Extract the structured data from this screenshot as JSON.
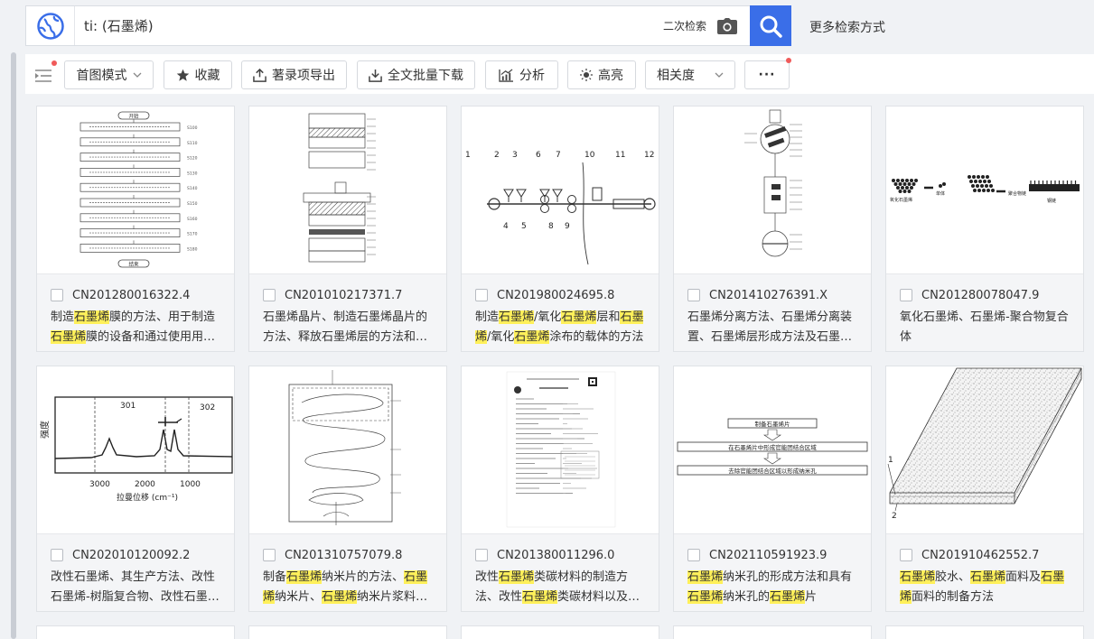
{
  "search": {
    "query": "ti: (石墨烯)",
    "secondary_label": "二次检索",
    "more_label": "更多检索方式"
  },
  "toolbar": {
    "mode_label": "首图模式",
    "favorite_label": "收藏",
    "export_label": "著录项导出",
    "download_label": "全文批量下载",
    "analysis_label": "分析",
    "highlight_label": "高亮",
    "sort_label": "相关度",
    "more_label": "···"
  },
  "results": [
    {
      "pn": "CN201280016322.4",
      "title": [
        {
          "t": "制造"
        },
        {
          "t": "石墨烯",
          "h": true
        },
        {
          "t": "膜的方法、用于制造"
        },
        {
          "t": "石墨烯",
          "h": true
        },
        {
          "t": "膜的设备和通过使用用于制造石墨烯膜的设备制造的石墨烯膜"
        }
      ]
    },
    {
      "pn": "CN201010217371.7",
      "title": [
        {
          "t": "石墨烯晶片、制造石墨烯晶片的方法、释放石墨烯层的方法和制造装置的方法"
        }
      ]
    },
    {
      "pn": "CN201980024695.8",
      "title": [
        {
          "t": "制造"
        },
        {
          "t": "石墨烯",
          "h": true
        },
        {
          "t": "/氧化"
        },
        {
          "t": "石墨烯",
          "h": true
        },
        {
          "t": "层和"
        },
        {
          "t": "石墨烯",
          "h": true
        },
        {
          "t": "/氧化"
        },
        {
          "t": "石墨烯",
          "h": true
        },
        {
          "t": "涂布的载体的方法"
        }
      ]
    },
    {
      "pn": "CN201410276391.X",
      "title": [
        {
          "t": "石墨烯分离方法、石墨烯分离装置、石墨烯层形成方法及石墨烯层形成装置"
        }
      ]
    },
    {
      "pn": "CN201280078047.9",
      "title": [
        {
          "t": "氧化石墨烯、石墨烯-聚合物复合体"
        }
      ]
    },
    {
      "pn": "CN202010120092.2",
      "title": [
        {
          "t": "改性石墨烯、其生产方法、改性石墨烯-树脂复合物、改性石墨烯片材及改性石墨烯分散液"
        }
      ]
    },
    {
      "pn": "CN201310757079.8",
      "title": [
        {
          "t": "制备"
        },
        {
          "t": "石墨烯",
          "h": true
        },
        {
          "t": "纳米片的方法、"
        },
        {
          "t": "石墨烯",
          "h": true
        },
        {
          "t": "纳米片、"
        },
        {
          "t": "石墨烯",
          "h": true
        },
        {
          "t": "纳米片浆料和包含石墨烯纳米片的制品"
        }
      ]
    },
    {
      "pn": "CN201380011296.0",
      "title": [
        {
          "t": "改性"
        },
        {
          "t": "石墨烯",
          "h": true
        },
        {
          "t": "类碳材料的制造方法、改性"
        },
        {
          "t": "石墨烯",
          "h": true
        },
        {
          "t": "类碳材料以及含有改性石墨烯类碳材料的树脂复合材料"
        }
      ]
    },
    {
      "pn": "CN202110591923.9",
      "title": [
        {
          "t": "石墨烯",
          "h": true
        },
        {
          "t": "纳米孔的形成方法和具有"
        },
        {
          "t": "石墨烯",
          "h": true
        },
        {
          "t": "纳米孔的"
        },
        {
          "t": "石墨烯",
          "h": true
        },
        {
          "t": "片"
        }
      ]
    },
    {
      "pn": "CN201910462552.7",
      "title": [
        {
          "t": "石墨烯",
          "h": true
        },
        {
          "t": "胶水、"
        },
        {
          "t": "石墨烯",
          "h": true
        },
        {
          "t": "面料及"
        },
        {
          "t": "石墨烯",
          "h": true
        },
        {
          "t": "面料的制备方法"
        }
      ]
    }
  ],
  "figures": {
    "fig1_label_start": "开始",
    "fig1_label_end": "结束",
    "fig1_steps": [
      "S100",
      "S110",
      "S120",
      "S130",
      "S140",
      "S150",
      "S160",
      "S170",
      "S180"
    ],
    "fig3_numbers": [
      "1",
      "2",
      "3",
      "6",
      "7",
      "10",
      "11",
      "12",
      "4",
      "5",
      "8",
      "9"
    ],
    "fig5_labels": [
      "氧化石墨烯",
      "单体",
      "聚合物链",
      "钢链"
    ],
    "fig6_ylabel": "强度",
    "fig6_xlabel": "拉曼位移 (cm⁻¹)",
    "fig6_ticks": [
      "3000",
      "2000",
      "1000"
    ],
    "fig6_peaks": [
      "301",
      "302"
    ],
    "fig9_steps": [
      "制备石墨烯片",
      "在石墨烯片中形成官能团结合区域",
      "去除官能团结合区域以形成纳米孔"
    ],
    "fig10_labels": [
      "1",
      "2"
    ]
  },
  "colors": {
    "accent": "#3a6ee8",
    "highlight": "#fff05a",
    "badge": "#f05a5a"
  },
  "icons": {
    "logo": "globe-icon",
    "camera": "camera-icon",
    "search": "search-icon"
  }
}
